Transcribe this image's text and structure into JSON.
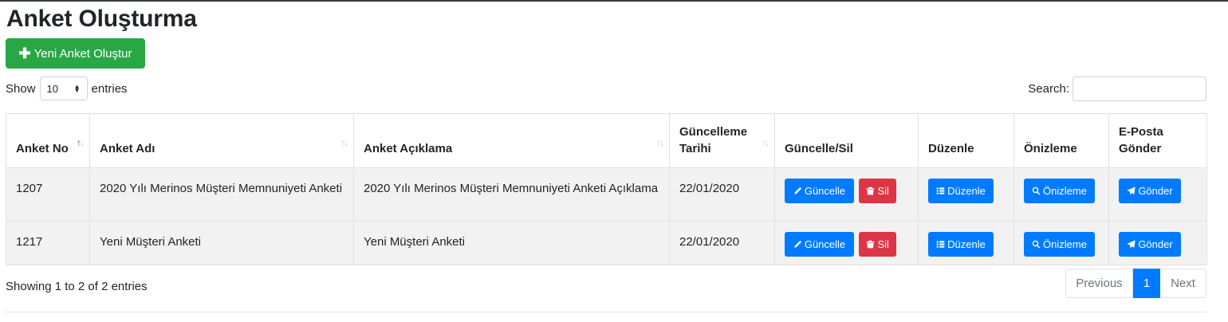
{
  "page": {
    "title": "Anket Oluşturma",
    "new_button": "Yeni Anket Oluştur"
  },
  "length_menu": {
    "show": "Show",
    "value": "10",
    "entries": "entries"
  },
  "search": {
    "label": "Search:",
    "value": ""
  },
  "table": {
    "headers": [
      "Anket No",
      "Anket Adı",
      "Anket Açıklama",
      "Güncelleme Tarihi",
      "Güncelle/Sil",
      "Düzenle",
      "Önizleme",
      "E-Posta Gönder"
    ],
    "rows": [
      {
        "no": "1207",
        "name": "2020 Yılı Merinos Müşteri Memnuniyeti Anketi",
        "description": "2020 Yılı Merinos Müşteri Memnuniyeti Anketi Açıklama",
        "date": "22/01/2020"
      },
      {
        "no": "1217",
        "name": "Yeni Müşteri Anketi",
        "description": "Yeni Müşteri Anketi",
        "date": "22/01/2020"
      }
    ],
    "actions": {
      "update": "Güncelle",
      "delete": "Sil",
      "edit": "Düzenle",
      "preview": "Önizleme",
      "send": "Gönder"
    }
  },
  "footer": {
    "info": "Showing 1 to 2 of 2 entries",
    "previous": "Previous",
    "page": "1",
    "next": "Next"
  },
  "colors": {
    "success": "#28a745",
    "primary": "#007bff",
    "danger": "#dc3545"
  }
}
